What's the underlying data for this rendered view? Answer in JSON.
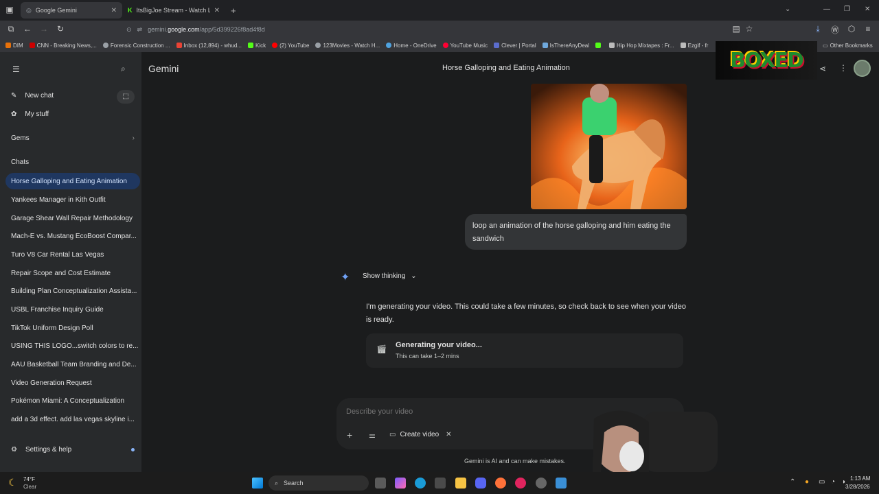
{
  "browser": {
    "tabs": [
      {
        "label": "Google Gemini",
        "active": true
      },
      {
        "label": "ItsBigJoe Stream - Watch Live o",
        "active": false
      }
    ],
    "url_prefix": "gemini.",
    "url_domain": "google.com",
    "url_path": "/app/5d399226f8ad4f8d",
    "bookmarks": [
      "DIM",
      "CNN - Breaking News,...",
      "Forensic Construction ...",
      "Inbox (12,894) - whud...",
      "Kick",
      "(2) YouTube",
      "123Movies - Watch H...",
      "Home - OneDrive",
      "YouTube Music",
      "Clever | Portal",
      "IsThereAnyDeal",
      "",
      "Hip Hop Mixtapes : Fr...",
      "Ezgif - fr"
    ],
    "other_bookmarks": "Other Bookmarks"
  },
  "sidebar": {
    "new_chat": "New chat",
    "my_stuff": "My stuff",
    "gems": "Gems",
    "chats_heading": "Chats",
    "chats": [
      "Horse Galloping and Eating Animation",
      "Yankees Manager in Kith Outfit",
      "Garage Shear Wall Repair Methodology",
      "Mach-E vs. Mustang EcoBoost Compar...",
      "Turo V8 Car Rental Las Vegas",
      "Repair Scope and Cost Estimate",
      "Building Plan Conceptualization Assista...",
      "USBL Franchise Inquiry Guide",
      "TikTok Uniform Design Poll",
      "USING THIS LOGO...switch colors to re...",
      "AAU Basketball Team Branding and De...",
      "Video Generation Request",
      "Pokémon Miami: A Conceptualization",
      "add a 3d effect. add las vegas skyline i..."
    ],
    "settings": "Settings & help"
  },
  "header": {
    "app_name": "Gemini",
    "conversation_title": "Horse Galloping and Eating Animation"
  },
  "conversation": {
    "user_message": "loop an animation of the horse galloping and him eating the sandwich",
    "show_thinking": "Show thinking",
    "response_text": "I'm generating your video. This could take a few minutes, so check back to see when your video is ready.",
    "gen_title": "Generating your video...",
    "gen_sub": "This can take 1–2 mins"
  },
  "composer": {
    "placeholder": "Describe your video",
    "chip_label": "Create video",
    "disclaimer": "Gemini is AI and can make mistakes."
  },
  "taskbar": {
    "weather_temp": "74°F",
    "weather_desc": "Clear",
    "search": "Search",
    "time": "1:13 AM",
    "date": "3/28/2026"
  },
  "overlay_logo": "BOXED"
}
